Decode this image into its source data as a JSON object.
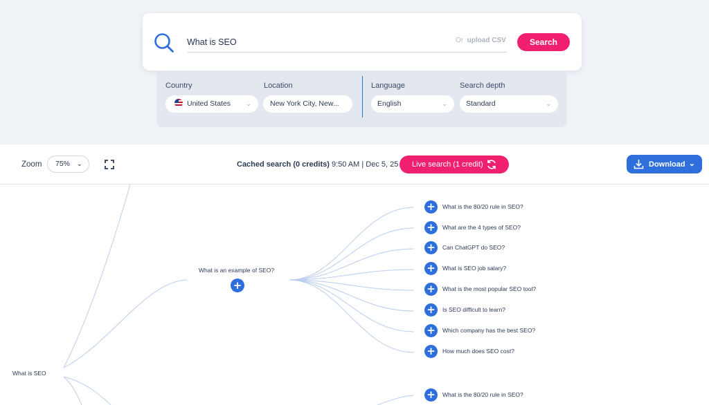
{
  "search": {
    "query": "What is SEO",
    "or_text": "Or",
    "upload_text": "upload CSV",
    "button_label": "Search"
  },
  "options": {
    "country_label": "Country",
    "country_value": "United States",
    "location_label": "Location",
    "location_value": "New York City, New...",
    "language_label": "Language",
    "language_value": "English",
    "depth_label": "Search depth",
    "depth_value": "Standard"
  },
  "toolbar": {
    "zoom_label": "Zoom",
    "zoom_value": "75%",
    "cached_bold": "Cached search (0 credits)",
    "cached_time": "9:50 AM | Dec 5, 25",
    "live_label": "Live search (1 credit)",
    "download_label": "Download"
  },
  "mindmap": {
    "root_label": "What is SEO",
    "branch_label": "What is an example of SEO?",
    "leaves": [
      "What is the 80/20 rule in SEO?",
      "What are the 4 types of SEO?",
      "Can ChatGPT do SEO?",
      "What is SEO job salary?",
      "What is the most popular SEO tool?",
      "Is SEO difficult to learn?",
      "Which company has the best SEO?",
      "How much does SEO cost?"
    ],
    "bottom_leaf": "What is the 80/20 rule in SEO?"
  },
  "colors": {
    "accent_pink": "#f0206f",
    "accent_blue": "#2f6fdc",
    "link_line": "#b9cdef"
  }
}
